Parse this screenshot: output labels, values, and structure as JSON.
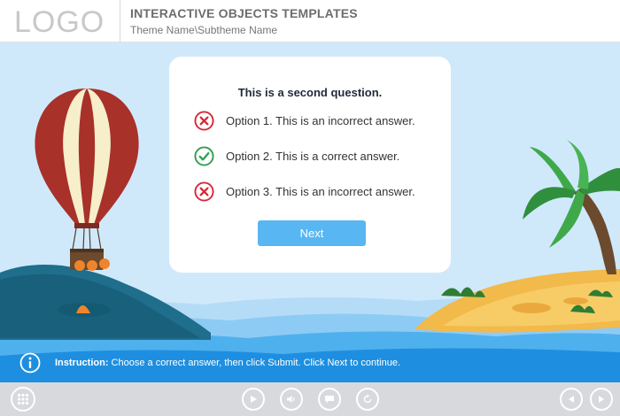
{
  "header": {
    "logo": "LOGO",
    "course_title": "INTERACTIVE OBJECTS TEMPLATES",
    "theme_name": "Theme Name\\Subtheme Name"
  },
  "quiz": {
    "question": "This is a second question.",
    "options": [
      {
        "label": "Option 1. This is an incorrect answer.",
        "status": "incorrect",
        "icon": "x-circle-icon"
      },
      {
        "label": "Option 2. This is a correct answer.",
        "status": "correct",
        "icon": "check-circle-icon"
      },
      {
        "label": "Option 3. This is an incorrect answer.",
        "status": "incorrect",
        "icon": "x-circle-icon"
      }
    ],
    "next_label": "Next"
  },
  "instruction": {
    "prefix": "Instruction:",
    "text": " Choose a correct answer, then click Submit. Click Next to continue."
  },
  "toolbar": {
    "icons": [
      "menu-grid-icon",
      "play-icon",
      "volume-icon",
      "caption-icon",
      "replay-icon",
      "previous-icon",
      "next-icon"
    ]
  },
  "colors": {
    "accent": "#58b6f2",
    "correct": "#2e9e4f",
    "incorrect": "#d62839",
    "sky": "#cfe9fb",
    "sea": "#1e8fe0",
    "toolbar": "#d7d9dc"
  }
}
